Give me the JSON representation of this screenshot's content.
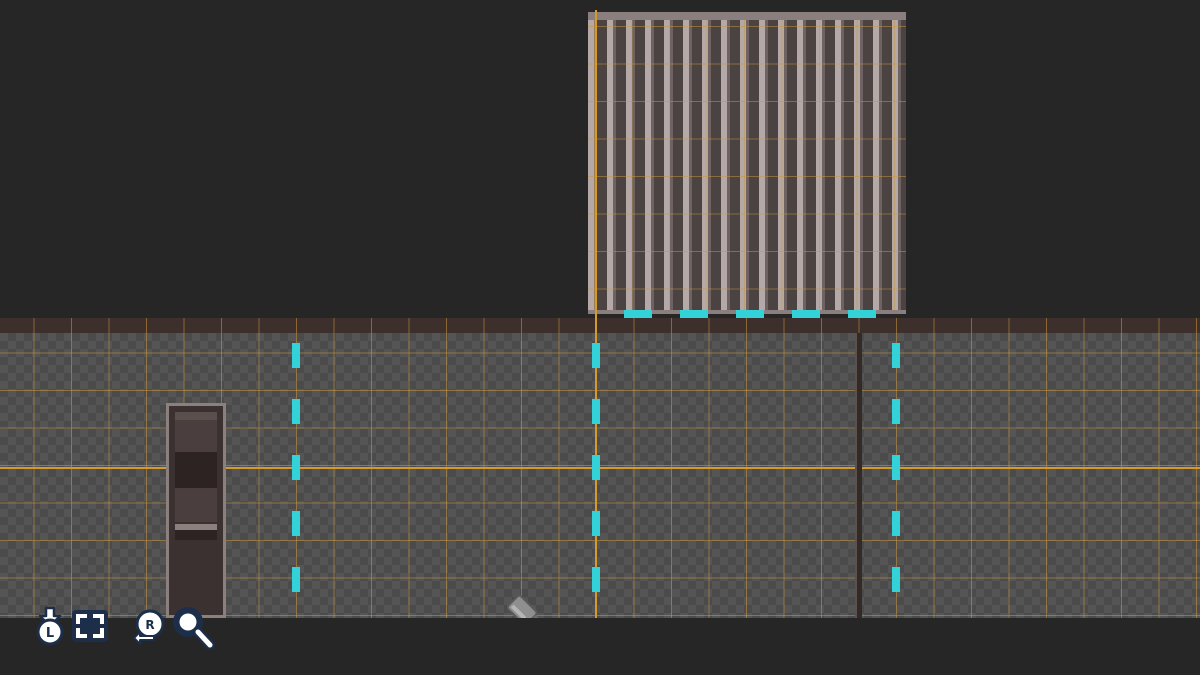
{
  "editor": {
    "mode": "course-maker",
    "cage_tile": {
      "name": "cage-block"
    },
    "objects": [
      {
        "name": "door"
      },
      {
        "name": "pole"
      }
    ],
    "cursor_tool": "eraser-icon"
  },
  "toolbar": {
    "buttons": [
      {
        "icon": "l-button-download-icon"
      },
      {
        "icon": "fullscreen-frame-icon"
      },
      {
        "icon": "r-button-zoom-out-icon"
      },
      {
        "icon": "magnifier-icon"
      }
    ],
    "button_labels": {
      "l": "L",
      "r": "R"
    }
  },
  "colors": {
    "background": "#262626",
    "grid": "#c8963c",
    "guide": "#d49a2a",
    "marker": "#32d2d8",
    "cage_bar": "#b4a9a6"
  }
}
